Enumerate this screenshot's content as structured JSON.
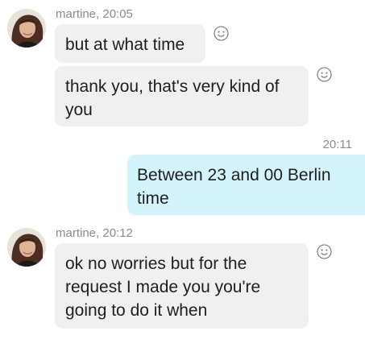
{
  "messages": [
    {
      "sender": "martine",
      "timestamp": "martine, 20:05",
      "direction": "incoming",
      "bubbles": [
        "but at what time",
        "thank you, that's very kind of you"
      ]
    },
    {
      "direction": "outgoing",
      "timestamp": "20:11",
      "bubbles": [
        "Between 23 and 00 Berlin time"
      ]
    },
    {
      "sender": "martine",
      "timestamp": "martine, 20:12",
      "direction": "incoming",
      "bubbles": [
        "ok no worries but for the request I made you you're going to do it when"
      ]
    }
  ],
  "icons": {
    "reaction": "smiley-face-icon",
    "avatar": "profile-photo"
  },
  "colors": {
    "incoming_bubble": "#f0f0f0",
    "outgoing_bubble": "#d3f4fb",
    "meta_text": "#8a8a8a",
    "message_text": "#1e1e1e"
  }
}
